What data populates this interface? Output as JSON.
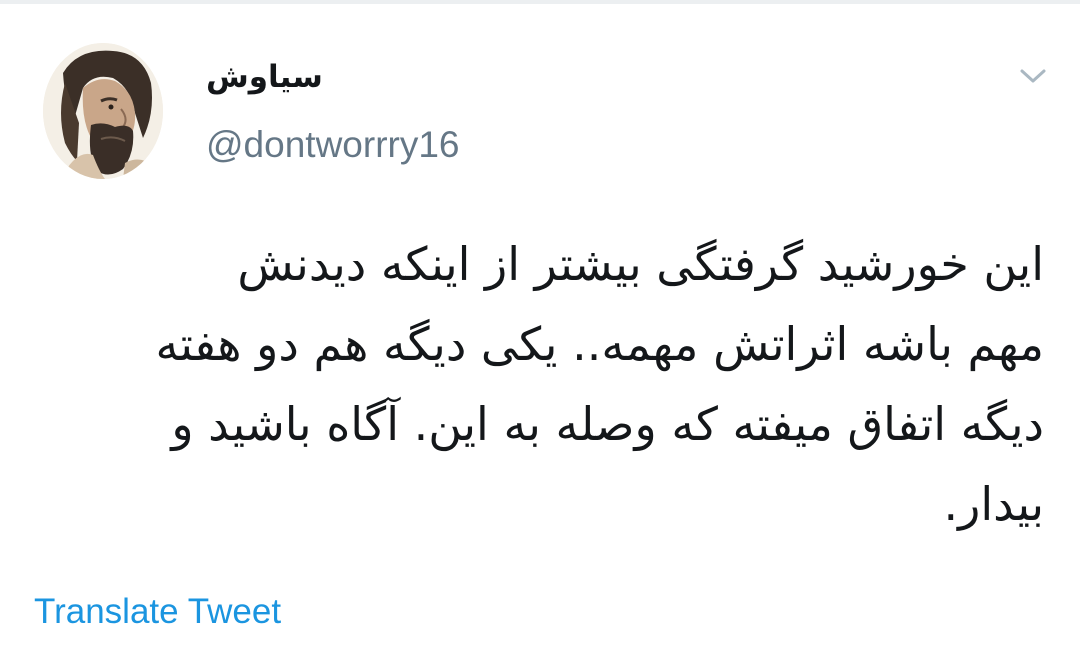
{
  "tweet": {
    "author": {
      "display_name": "سیاوش",
      "handle": "@dontworrry16",
      "avatar_icon": "user-avatar"
    },
    "more_options_icon": "chevron-down-icon",
    "text_lines": [
      "این خورشید گرفتگی بیشتر از اینکه دیدنش",
      "مهم باشه اثراتش مهمه.. یکی دیگه هم دو هفته",
      "دیگه اتفاق میفته که وصله به این. آگاه باشید و",
      "بیدار."
    ],
    "translate_label": "Translate Tweet"
  },
  "colors": {
    "text": "#14171a",
    "secondary": "#657786",
    "link": "#1b95e0",
    "divider": "#eceff1"
  }
}
